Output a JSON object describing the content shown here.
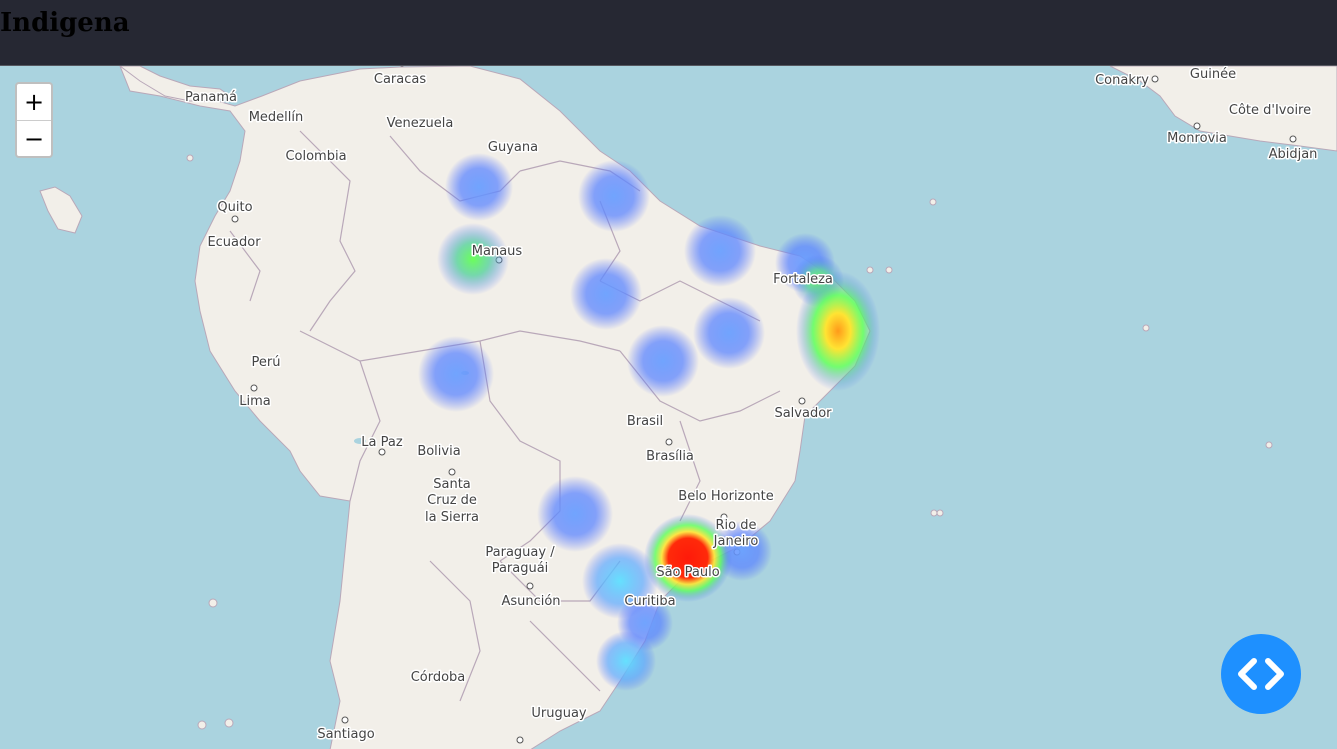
{
  "app": {
    "title": "Indigena"
  },
  "map": {
    "zoom_in_label": "+",
    "zoom_out_label": "−",
    "labels": {
      "caracas": "Caracas",
      "panama": "Panamá",
      "medellin": "Medellín",
      "venezuela": "Venezuela",
      "guyana": "Guyana",
      "colombia": "Colombia",
      "quito": "Quito",
      "ecuador": "Ecuador",
      "manaus": "Manaus",
      "fortaleza": "Fortaleza",
      "peru": "Perú",
      "lima": "Lima",
      "salvador": "Salvador",
      "brasil": "Brasil",
      "brasilia": "Brasília",
      "la_paz": "La Paz",
      "bolivia": "Bolivia",
      "santa_cruz_1": "Santa",
      "santa_cruz_2": "Cruz de",
      "santa_cruz_3": "la Sierra",
      "belo_horizonte": "Belo Horizonte",
      "rio_1": "Rio de",
      "rio_2": "Janeiro",
      "sao_paulo": "São Paulo",
      "paraguay_1": "Paraguay /",
      "paraguay_2": "Paraguái",
      "asuncion": "Asunción",
      "curitiba": "Curitiba",
      "cordoba": "Córdoba",
      "uruguay": "Uruguay",
      "santiago": "Santiago",
      "conakry": "Conakry",
      "guinee": "Guinée",
      "cote_divoire": "Côte d'Ivoire",
      "monrovia": "Monrovia",
      "abidjan": "Abidjan"
    },
    "heat_colors": {
      "low": "#5b8cff",
      "mid": "#4cff6a",
      "high": "#ffe433",
      "peak": "#ff1a0a"
    }
  },
  "code_button": {
    "icon": "code-icon"
  }
}
